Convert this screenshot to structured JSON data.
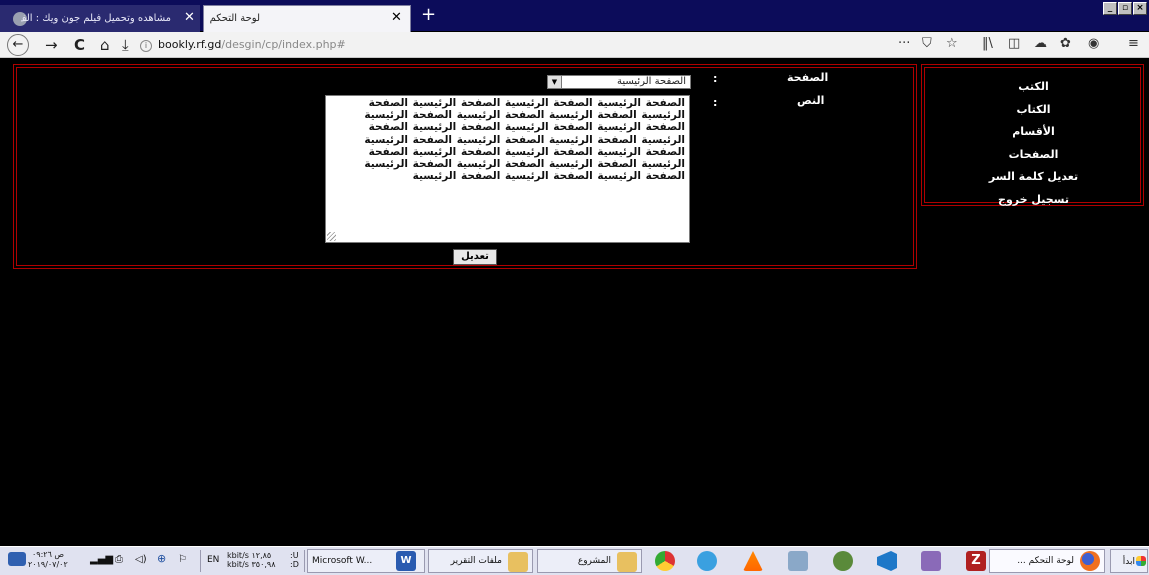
{
  "browser": {
    "tabs": [
      {
        "title": "مشاهده وتحميل فيلم جون ويك : الف",
        "active": false
      },
      {
        "title": "لوحة التحكم",
        "active": true
      }
    ],
    "new_tab": "+",
    "url_host": "bookly.rf.gd",
    "url_path": "/desgin/cp/index.php#",
    "window_controls": [
      "_",
      "▫",
      "×"
    ]
  },
  "sidebar": {
    "items": [
      {
        "label": "الكتب"
      },
      {
        "label": "الكتاب"
      },
      {
        "label": "الأقسام"
      },
      {
        "label": "الصفحات"
      },
      {
        "label": "تعديل كلمة السر"
      },
      {
        "label": "تسجيل خروج"
      }
    ]
  },
  "form": {
    "page_label": "الصفحة",
    "page_colon": ":",
    "page_select_value": "الصفحة الرئيسية",
    "text_label": "النص",
    "text_colon": ":",
    "text_value": "الصفحة الرئيسية الصفحة الرئيسية الصفحة الرئيسية الصفحة الرئيسية الصفحة الرئيسية الصفحة الرئيسية الصفحة الرئيسية الصفحة الرئيسية الصفحة الرئيسية الصفحة الرئيسية الصفحة الرئيسية الصفحة الرئيسية الصفحة الرئيسية الصفحة الرئيسية الصفحة الرئيسية الصفحة الرئيسية الصفحة الرئيسية الصفحة الرئيسية الصفحة الرئيسية الصفحة الرئيسية الصفحة الرئيسية الصفحة الرئيسية الصفحة الرئيسية الصفحة الرئيسية",
    "submit_label": "تعديل"
  },
  "taskbar": {
    "start_label": "ابدأ",
    "windows": [
      {
        "label": "لوحة التحكم ..."
      },
      {
        "label": "المشروع"
      },
      {
        "label": "ملفات التقرير"
      },
      {
        "label": "Microsoft W..."
      }
    ],
    "tray_lang": "EN",
    "tray_speed_up": "kbit/s ١٢,٨٥",
    "tray_speed_down": "kbit/s ٣٥٠,٩٨",
    "tray_ud_u": ":U",
    "tray_ud_d": ":D",
    "clock_time": "ص ٠٩:٢٦",
    "clock_date": "٢٠١٩/٠٧/٠٢"
  },
  "colors": {
    "tabbar_bg": "#0c0c5a",
    "panel_border": "#b00000",
    "page_bg": "#000000"
  }
}
